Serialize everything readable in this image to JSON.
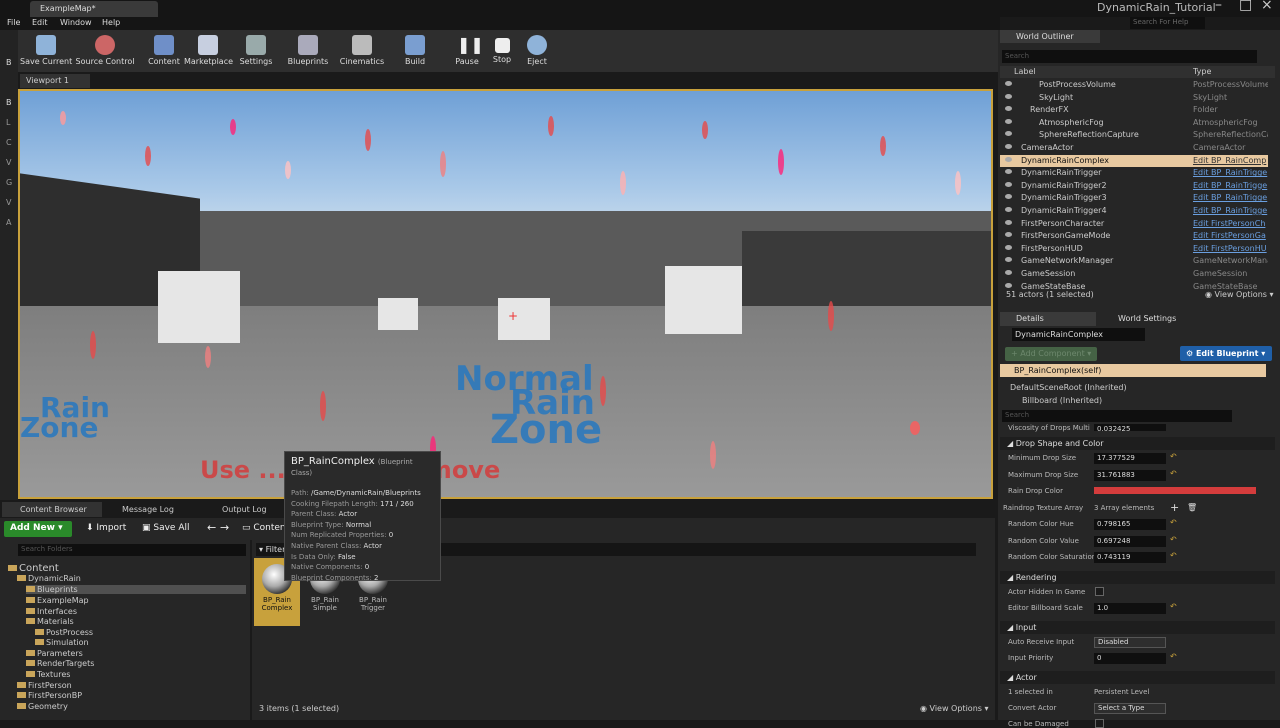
{
  "window": {
    "tab": "ExampleMap*",
    "project_title": "DynamicRain_Tutorial",
    "search_help_placeholder": "Search For Help",
    "menu": [
      "File",
      "Edit",
      "Window",
      "Help"
    ]
  },
  "left_tools": [
    "B",
    "L",
    "C",
    "V",
    "G",
    "V",
    "A"
  ],
  "toolbar": [
    {
      "label": "Save Current",
      "icon": "save-icon"
    },
    {
      "label": "Source Control",
      "icon": "source-control-icon"
    },
    {
      "label": "Content",
      "icon": "content-icon"
    },
    {
      "label": "Marketplace",
      "icon": "marketplace-icon"
    },
    {
      "label": "Settings",
      "icon": "settings-icon"
    },
    {
      "label": "Blueprints",
      "icon": "blueprints-icon"
    },
    {
      "label": "Cinematics",
      "icon": "cinematics-icon"
    },
    {
      "label": "Build",
      "icon": "build-icon"
    },
    {
      "label": "Pause",
      "icon": "pause-icon"
    },
    {
      "label": "Stop",
      "icon": "stop-icon"
    },
    {
      "label": "Eject",
      "icon": "eject-icon"
    }
  ],
  "viewport": {
    "tab": "Viewport 1",
    "zone_text": [
      "Normal",
      "Rain",
      "Zone"
    ],
    "left_zone_text": [
      "Rain",
      "Zone"
    ],
    "bottom_text": "Use ... Mouse to move"
  },
  "content_browser": {
    "tabs": [
      "Content Browser",
      "Message Log",
      "Output Log"
    ],
    "add_new": "Add New",
    "import": "Import",
    "save_all": "Save All",
    "path": "Conten",
    "folder_search_placeholder": "Search Folders",
    "filters": "Filter",
    "tree": [
      {
        "label": "Content",
        "level": 0
      },
      {
        "label": "DynamicRain",
        "level": 1
      },
      {
        "label": "Blueprints",
        "level": 2
      },
      {
        "label": "ExampleMap",
        "level": 2
      },
      {
        "label": "Interfaces",
        "level": 2
      },
      {
        "label": "Materials",
        "level": 2
      },
      {
        "label": "PostProcess",
        "level": 3
      },
      {
        "label": "Simulation",
        "level": 3
      },
      {
        "label": "Parameters",
        "level": 2
      },
      {
        "label": "RenderTargets",
        "level": 2
      },
      {
        "label": "Textures",
        "level": 2
      },
      {
        "label": "FirstPerson",
        "level": 1
      },
      {
        "label": "FirstPersonBP",
        "level": 1
      },
      {
        "label": "Geometry",
        "level": 1
      }
    ],
    "assets": [
      {
        "line1": "BP_Rain",
        "line2": "Complex",
        "selected": true
      },
      {
        "line1": "BP_Rain",
        "line2": "Simple",
        "selected": false
      },
      {
        "line1": "BP_Rain",
        "line2": "Trigger",
        "selected": false
      }
    ],
    "status": "3 items (1 selected)",
    "view_options": "View Options"
  },
  "tooltip": {
    "title": "BP_RainComplex",
    "subtitle": "(Blueprint Class)",
    "rows": [
      {
        "k": "Path:",
        "v": "/Game/DynamicRain/Blueprints"
      },
      {
        "k": "Cooking Filepath Length:",
        "v": "171 / 260"
      },
      {
        "k": "Parent Class:",
        "v": "Actor"
      },
      {
        "k": "Blueprint Type:",
        "v": "Normal"
      },
      {
        "k": "Num Replicated Properties:",
        "v": "0"
      },
      {
        "k": "Native Parent Class:",
        "v": "Actor"
      },
      {
        "k": "Is Data Only:",
        "v": "False"
      },
      {
        "k": "Native Components:",
        "v": "0"
      },
      {
        "k": "Blueprint Components:",
        "v": "2"
      }
    ]
  },
  "outliner": {
    "tab": "World Outliner",
    "search_placeholder": "Search",
    "col_label": "Label",
    "col_type": "Type",
    "rows": [
      {
        "name": "PostProcessVolume",
        "type": "PostProcessVolume",
        "indent": 3,
        "link": false,
        "sel": false
      },
      {
        "name": "SkyLight",
        "type": "SkyLight",
        "indent": 3,
        "link": false,
        "sel": false
      },
      {
        "name": "RenderFX",
        "type": "Folder",
        "indent": 2,
        "link": false,
        "sel": false
      },
      {
        "name": "AtmosphericFog",
        "type": "AtmosphericFog",
        "indent": 3,
        "link": false,
        "sel": false
      },
      {
        "name": "SphereReflectionCapture",
        "type": "SphereReflectionCap",
        "indent": 3,
        "link": false,
        "sel": false
      },
      {
        "name": "CameraActor",
        "type": "CameraActor",
        "indent": 1,
        "link": false,
        "sel": false
      },
      {
        "name": "DynamicRainComplex",
        "type": "Edit BP_RainComp",
        "indent": 1,
        "link": true,
        "sel": true
      },
      {
        "name": "DynamicRainTrigger",
        "type": "Edit BP_RainTrigge",
        "indent": 1,
        "link": true,
        "sel": false
      },
      {
        "name": "DynamicRainTrigger2",
        "type": "Edit BP_RainTrigge",
        "indent": 1,
        "link": true,
        "sel": false
      },
      {
        "name": "DynamicRainTrigger3",
        "type": "Edit BP_RainTrigge",
        "indent": 1,
        "link": true,
        "sel": false
      },
      {
        "name": "DynamicRainTrigger4",
        "type": "Edit BP_RainTrigge",
        "indent": 1,
        "link": true,
        "sel": false
      },
      {
        "name": "FirstPersonCharacter",
        "type": "Edit FirstPersonCh",
        "indent": 1,
        "link": true,
        "sel": false
      },
      {
        "name": "FirstPersonGameMode",
        "type": "Edit FirstPersonGa",
        "indent": 1,
        "link": true,
        "sel": false
      },
      {
        "name": "FirstPersonHUD",
        "type": "Edit FirstPersonHU",
        "indent": 1,
        "link": true,
        "sel": false
      },
      {
        "name": "GameNetworkManager",
        "type": "GameNetworkManag",
        "indent": 1,
        "link": false,
        "sel": false
      },
      {
        "name": "GameSession",
        "type": "GameSession",
        "indent": 1,
        "link": false,
        "sel": false
      },
      {
        "name": "GameStateBase",
        "type": "GameStateBase",
        "indent": 1,
        "link": false,
        "sel": false
      }
    ],
    "count": "51 actors (1 selected)",
    "view_options": "View Options"
  },
  "details": {
    "tabs": [
      "Details",
      "World Settings"
    ],
    "name": "DynamicRainComplex",
    "add_component": "Add Component",
    "edit_blueprint": "Edit Blueprint",
    "component_self": "BP_RainComplex(self)",
    "components": [
      "DefaultSceneRoot (Inherited)",
      "Billboard (Inherited)"
    ],
    "search_placeholder": "Search",
    "partial_row": {
      "label": "Viscosity of Drops Multi",
      "value": "0.032425"
    },
    "categories": [
      {
        "title": "Drop Shape and Color",
        "props": [
          {
            "label": "Minimum Drop Size",
            "value": "17.377529",
            "kind": "num"
          },
          {
            "label": "Maximum Drop Size",
            "value": "31.761883",
            "kind": "num"
          },
          {
            "label": "Rain Drop Color",
            "value": "",
            "kind": "color"
          },
          {
            "label": "Raindrop Texture Array",
            "value": "3 Array elements",
            "kind": "array"
          },
          {
            "label": "Random Color Hue",
            "value": "0.798165",
            "kind": "num"
          },
          {
            "label": "Random Color Value",
            "value": "0.697248",
            "kind": "num"
          },
          {
            "label": "Random Color Saturation",
            "value": "0.743119",
            "kind": "num"
          }
        ]
      },
      {
        "title": "Rendering",
        "props": [
          {
            "label": "Actor Hidden In Game",
            "value": "",
            "kind": "check"
          },
          {
            "label": "Editor Billboard Scale",
            "value": "1.0",
            "kind": "num"
          }
        ]
      },
      {
        "title": "Input",
        "props": [
          {
            "label": "Auto Receive Input",
            "value": "Disabled",
            "kind": "drop"
          },
          {
            "label": "Input Priority",
            "value": "0",
            "kind": "num"
          }
        ]
      },
      {
        "title": "Actor",
        "props": [
          {
            "label": "1 selected in",
            "value": "Persistent Level",
            "kind": "text"
          },
          {
            "label": "Convert Actor",
            "value": "Select a Type",
            "kind": "drop"
          },
          {
            "label": "Can be Damaged",
            "value": "",
            "kind": "check"
          }
        ]
      }
    ]
  },
  "colors": {
    "accent": "#c8a13c",
    "selection": "#e8c9a0",
    "addnew": "#2a8a2a",
    "editbp": "#1f5fa8",
    "raindrop": "#d43c3c",
    "zone": "#2778c0"
  }
}
